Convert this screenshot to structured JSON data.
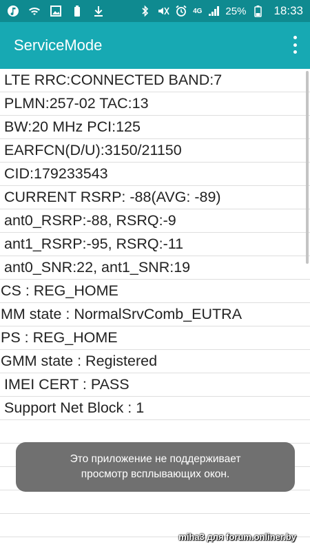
{
  "status_bar": {
    "left_icons": [
      "music-note-icon",
      "wifi-call-icon",
      "gallery-icon",
      "battery-saver-icon",
      "download-icon"
    ],
    "right_icons": [
      "bluetooth-icon",
      "mute-icon",
      "alarm-icon"
    ],
    "network_type": "4G",
    "battery_percent": "25%",
    "time": "18:33"
  },
  "app_bar": {
    "title": "ServiceMode",
    "menu_icon": "more-vert-icon"
  },
  "rows": [
    {
      "text": "LTE RRC:CONNECTED BAND:7",
      "indent": true
    },
    {
      "text": "PLMN:257-02 TAC:13",
      "indent": true
    },
    {
      "text": "BW:20 MHz PCI:125",
      "indent": true
    },
    {
      "text": "EARFCN(D/U):3150/21150",
      "indent": true
    },
    {
      "text": "CID:179233543",
      "indent": true
    },
    {
      "text": "CURRENT RSRP: -88(AVG: -89)",
      "indent": true
    },
    {
      "text": "ant0_RSRP:-88, RSRQ:-9",
      "indent": true
    },
    {
      "text": "ant1_RSRP:-95, RSRQ:-11",
      "indent": true
    },
    {
      "text": "ant0_SNR:22, ant1_SNR:19",
      "indent": true
    },
    {
      "text": "CS : REG_HOME",
      "indent": false
    },
    {
      "text": "MM state : NormalSrvComb_EUTRA",
      "indent": false
    },
    {
      "text": "PS : REG_HOME",
      "indent": false
    },
    {
      "text": "GMM state : Registered",
      "indent": false
    },
    {
      "text": " IMEI CERT : PASS",
      "indent": true
    },
    {
      "text": "Support Net Block : 1",
      "indent": true
    },
    {
      "text": "",
      "indent": true
    },
    {
      "text": "",
      "indent": true
    },
    {
      "text": "",
      "indent": true
    },
    {
      "text": "",
      "indent": true
    },
    {
      "text": "",
      "indent": true
    },
    {
      "text": "",
      "indent": true
    }
  ],
  "toast": {
    "line1": "Это приложение не поддерживает",
    "line2": "просмотр всплывающих окон."
  },
  "watermark": "miha3 для forum.onliner.by",
  "colors": {
    "status_bar": "#0f8a90",
    "app_bar": "#17a9b3",
    "toast": "#707070"
  }
}
